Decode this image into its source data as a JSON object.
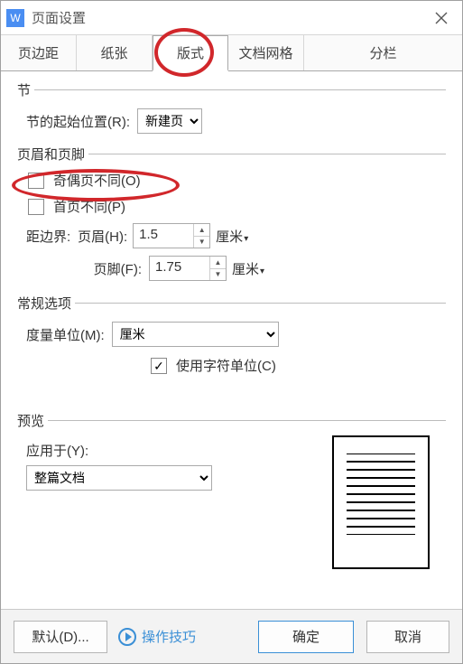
{
  "window": {
    "title": "页面设置",
    "appIconLetter": "W"
  },
  "tabs": {
    "margins": "页边距",
    "paper": "纸张",
    "layout": "版式",
    "grid": "文档网格",
    "columns": "分栏"
  },
  "section": {
    "group": "节",
    "startLabel": "节的起始位置(R):",
    "startValue": "新建页"
  },
  "headerFooter": {
    "group": "页眉和页脚",
    "oddEven": "奇偶页不同(O)",
    "firstPage": "首页不同(P)",
    "distancePrefix": "距边界:",
    "headerLabel": "页眉(H):",
    "headerValue": "1.5",
    "footerLabel": "页脚(F):",
    "footerValue": "1.75",
    "unit": "厘米"
  },
  "general": {
    "group": "常规选项",
    "unitLabel": "度量单位(M):",
    "unitValue": "厘米",
    "useChar": "使用字符单位(C)"
  },
  "preview": {
    "group": "预览",
    "applyLabel": "应用于(Y):",
    "applyValue": "整篇文档"
  },
  "footer": {
    "default": "默认(D)...",
    "tips": "操作技巧",
    "ok": "确定",
    "cancel": "取消"
  }
}
